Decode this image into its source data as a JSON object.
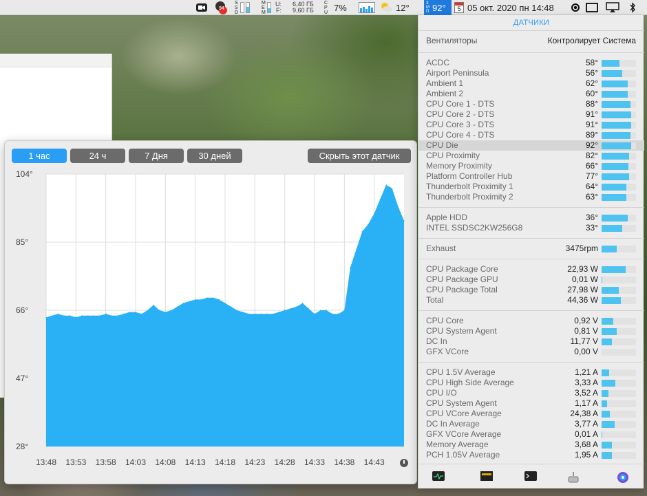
{
  "menubar": {
    "ssd_label": "SSD",
    "mem_label": "MEM",
    "mem_used_label": "U:",
    "mem_free_label": "F:",
    "mem_used": "6,40 ГБ",
    "mem_free": "9,60 ГБ",
    "cpu_label": "CPU",
    "cpu_percent": "7%",
    "weather_temp": "12°",
    "sensor_label": "ЗМП",
    "sensor_temp": "92°",
    "calendar_day": "5",
    "datetime": "05 окт. 2020 пн 14:48",
    "notification_count": "94"
  },
  "graph": {
    "tabs": [
      "1 час",
      "24 ч",
      "7 Дня",
      "30 дней"
    ],
    "active_tab": 0,
    "hide_button": "Скрыть этот датчик"
  },
  "chart_data": {
    "type": "area",
    "y_ticks": [
      "104°",
      "85°",
      "66°",
      "47°",
      "28°"
    ],
    "ylim": [
      28,
      104
    ],
    "x_ticks": [
      "13:48",
      "13:53",
      "13:58",
      "14:03",
      "14:08",
      "14:13",
      "14:18",
      "14:23",
      "14:28",
      "14:33",
      "14:38",
      "14:43"
    ],
    "xlim": [
      "13:48",
      "14:48"
    ],
    "grid": true,
    "color": "#2ab0f5",
    "x": [
      "13:48",
      "13:49",
      "13:50",
      "13:51",
      "13:52",
      "13:53",
      "13:54",
      "13:55",
      "13:56",
      "13:57",
      "13:58",
      "13:59",
      "14:00",
      "14:01",
      "14:02",
      "14:03",
      "14:04",
      "14:05",
      "14:06",
      "14:07",
      "14:08",
      "14:09",
      "14:10",
      "14:11",
      "14:12",
      "14:13",
      "14:14",
      "14:15",
      "14:16",
      "14:17",
      "14:18",
      "14:19",
      "14:20",
      "14:21",
      "14:22",
      "14:23",
      "14:24",
      "14:25",
      "14:26",
      "14:27",
      "14:28",
      "14:29",
      "14:30",
      "14:31",
      "14:32",
      "14:33",
      "14:34",
      "14:35",
      "14:36",
      "14:37",
      "14:38",
      "14:39",
      "14:40",
      "14:41",
      "14:42",
      "14:43",
      "14:44",
      "14:45",
      "14:46",
      "14:47",
      "14:48"
    ],
    "values": [
      64,
      64.5,
      65,
      64.5,
      64.5,
      64,
      64.5,
      64.5,
      64.5,
      64.5,
      65,
      64.5,
      64.5,
      65,
      65.5,
      65.5,
      65,
      66,
      67.5,
      66,
      65.5,
      66,
      67,
      68,
      68.5,
      69,
      69,
      69.5,
      69.5,
      69,
      68,
      67,
      66,
      65.5,
      65,
      65,
      65,
      65,
      65,
      65.5,
      66,
      66.5,
      67,
      68,
      66.5,
      65,
      66,
      66,
      65,
      65,
      66,
      78,
      83,
      88,
      90,
      93,
      97,
      101,
      100,
      95,
      91
    ]
  },
  "sensors": {
    "header": "ДАТЧИКИ",
    "fans_label": "Вентиляторы",
    "fans_value": "Контролирует Система",
    "rows": [
      {
        "name": "ACDC",
        "value": "58°",
        "level": 0.52
      },
      {
        "name": "Airport Peninsula",
        "value": "56°",
        "level": 0.6
      },
      {
        "name": "Ambient 1",
        "value": "62°",
        "level": 0.76
      },
      {
        "name": "Ambient 2",
        "value": "60°",
        "level": 0.76
      },
      {
        "name": "CPU Core 1 - DTS",
        "value": "88°",
        "level": 0.84
      },
      {
        "name": "CPU Core 2 - DTS",
        "value": "91°",
        "level": 0.86
      },
      {
        "name": "CPU Core 3 - DTS",
        "value": "91°",
        "level": 0.86
      },
      {
        "name": "CPU Core 4 - DTS",
        "value": "89°",
        "level": 0.84
      },
      {
        "name": "CPU Die",
        "value": "92°",
        "level": 0.86
      },
      {
        "name": "CPU Proximity",
        "value": "82°",
        "level": 0.8
      },
      {
        "name": "Memory Proximity",
        "value": "66°",
        "level": 0.78
      },
      {
        "name": "Platform Controller Hub",
        "value": "77°",
        "level": 0.8
      },
      {
        "name": "Thunderbolt Proximity 1",
        "value": "64°",
        "level": 0.72
      },
      {
        "name": "Thunderbolt Proximity 2",
        "value": "63°",
        "level": 0.72
      },
      {
        "name": "Apple HDD",
        "value": "36°",
        "level": 0.76
      },
      {
        "name": "INTEL SSDSC2KW256G8",
        "value": "33°",
        "level": 0.6
      },
      {
        "name": "Exhaust",
        "value": "3475rpm",
        "level": 0.44
      },
      {
        "name": "CPU Package Core",
        "value": "22,93 W",
        "level": 0.7
      },
      {
        "name": "CPU Package GPU",
        "value": "0,01 W",
        "level": 0.02
      },
      {
        "name": "CPU Package Total",
        "value": "27,98 W",
        "level": 0.5
      },
      {
        "name": "Total",
        "value": "44,36 W",
        "level": 0.56
      },
      {
        "name": "CPU Core",
        "value": "0,92 V",
        "level": 0.34
      },
      {
        "name": "CPU System Agent",
        "value": "0,81 V",
        "level": 0.44
      },
      {
        "name": "DC In",
        "value": "11,77 V",
        "level": 0.3
      },
      {
        "name": "GFX VCore",
        "value": "0,00 V",
        "level": 0.0
      },
      {
        "name": "CPU 1.5V Average",
        "value": "1,21 A",
        "level": 0.22
      },
      {
        "name": "CPU High Side Average",
        "value": "3,33 A",
        "level": 0.4
      },
      {
        "name": "CPU I/O",
        "value": "3,52 A",
        "level": 0.2
      },
      {
        "name": "CPU System Agent",
        "value": "1,17 A",
        "level": 0.16
      },
      {
        "name": "CPU VCore Average",
        "value": "24,38 A",
        "level": 0.24
      },
      {
        "name": "DC In Average",
        "value": "3,77 A",
        "level": 0.38
      },
      {
        "name": "GFX VCore Average",
        "value": "0,01 A",
        "level": 0.02
      },
      {
        "name": "Memory Average",
        "value": "3,68 A",
        "level": 0.3
      },
      {
        "name": "PCH 1.05V Average",
        "value": "1,95 A",
        "level": 0.3
      }
    ]
  }
}
